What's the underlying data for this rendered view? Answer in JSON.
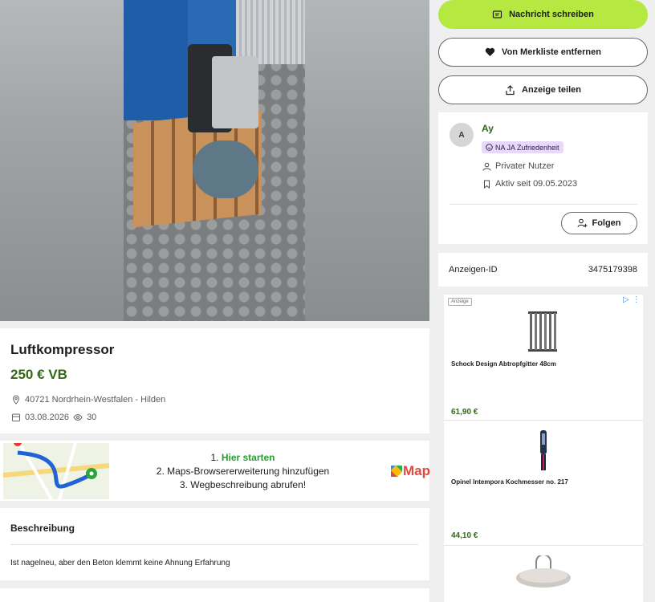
{
  "listing": {
    "title": "Luftkompressor",
    "price": "250 € VB",
    "location": "40721 Nordrhein-Westfalen - Hilden",
    "date": "03.08.2026",
    "views": "30"
  },
  "banner": {
    "step1_prefix": "1. ",
    "step1_link": "Hier starten",
    "step2": "2. Maps-Browsererweiterung hinzufügen",
    "step3": "3. Wegbeschreibung abrufen!",
    "logo_text": "Map"
  },
  "description": {
    "heading": "Beschreibung",
    "text": "Ist nagelneu, aber den Beton klemmt keine Ahnung Erfahrung"
  },
  "actions": {
    "message": "Nachricht schreiben",
    "watchlist": "Von Merkliste entfernen",
    "share": "Anzeige teilen"
  },
  "seller": {
    "initial": "A",
    "name": "Ay",
    "badge": "NA JA Zufriedenheit",
    "type": "Privater Nutzer",
    "active_since": "Aktiv seit 09.05.2023",
    "follow": "Folgen"
  },
  "ad_id": {
    "label": "Anzeigen-ID",
    "value": "3475179398"
  },
  "ads": {
    "label": "Anzeige",
    "items": [
      {
        "name": "Schock Design Abtropfgitter 48cm",
        "price": "61,90 €",
        "icon": "dish-rack-image"
      },
      {
        "name": "Opinel Intempora Kochmesser no. 217",
        "price": "44,10 €",
        "icon": "knife-image"
      },
      {
        "name": "",
        "price": "",
        "icon": "tray-image"
      }
    ]
  },
  "colors": {
    "accent": "#b5e941",
    "price_green": "#326916",
    "badge_purple": "#e8d9fb"
  }
}
